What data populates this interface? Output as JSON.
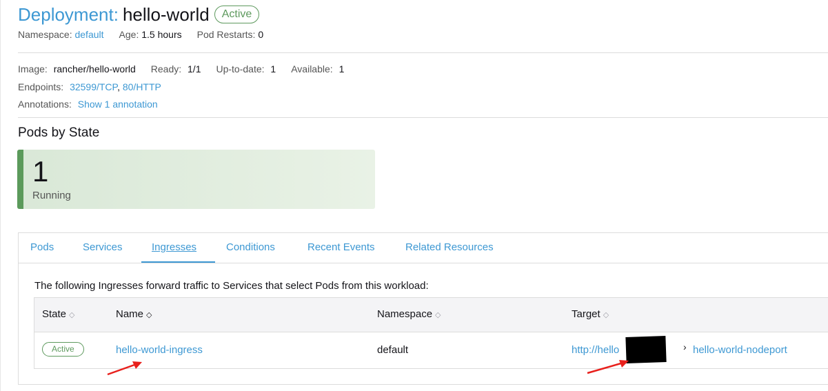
{
  "header": {
    "kind": "Deployment:",
    "name": "hello-world",
    "status": "Active",
    "meta": {
      "namespace_label": "Namespace:",
      "namespace_value": "default",
      "age_label": "Age:",
      "age_value": "1.5 hours",
      "restarts_label": "Pod Restarts:",
      "restarts_value": "0"
    }
  },
  "details": {
    "image_label": "Image:",
    "image_value": "rancher/hello-world",
    "ready_label": "Ready:",
    "ready_value": "1/1",
    "uptodate_label": "Up-to-date:",
    "uptodate_value": "1",
    "available_label": "Available:",
    "available_value": "1",
    "endpoints_label": "Endpoints:",
    "endpoint_1": "32599/TCP",
    "endpoint_sep": ",",
    "endpoint_2": "80/HTTP",
    "annotations_label": "Annotations:",
    "annotations_link": "Show 1 annotation"
  },
  "pods_by_state": {
    "title": "Pods by State",
    "count": "1",
    "state": "Running"
  },
  "tabs": {
    "items": [
      "Pods",
      "Services",
      "Ingresses",
      "Conditions",
      "Recent Events",
      "Related Resources"
    ],
    "active": "Ingresses"
  },
  "ingresses": {
    "intro": "The following Ingresses forward traffic to Services that select Pods from this workload:",
    "columns": [
      "State",
      "Name",
      "Namespace",
      "Target"
    ],
    "rows": [
      {
        "state": "Active",
        "name": "hello-world-ingress",
        "namespace": "default",
        "target_url": "http://hello",
        "target_service": "hello-world-nodeport"
      }
    ]
  },
  "colors": {
    "link": "#3d98d3",
    "active_green": "#5d995d",
    "annotation_arrow": "#e8201c"
  }
}
